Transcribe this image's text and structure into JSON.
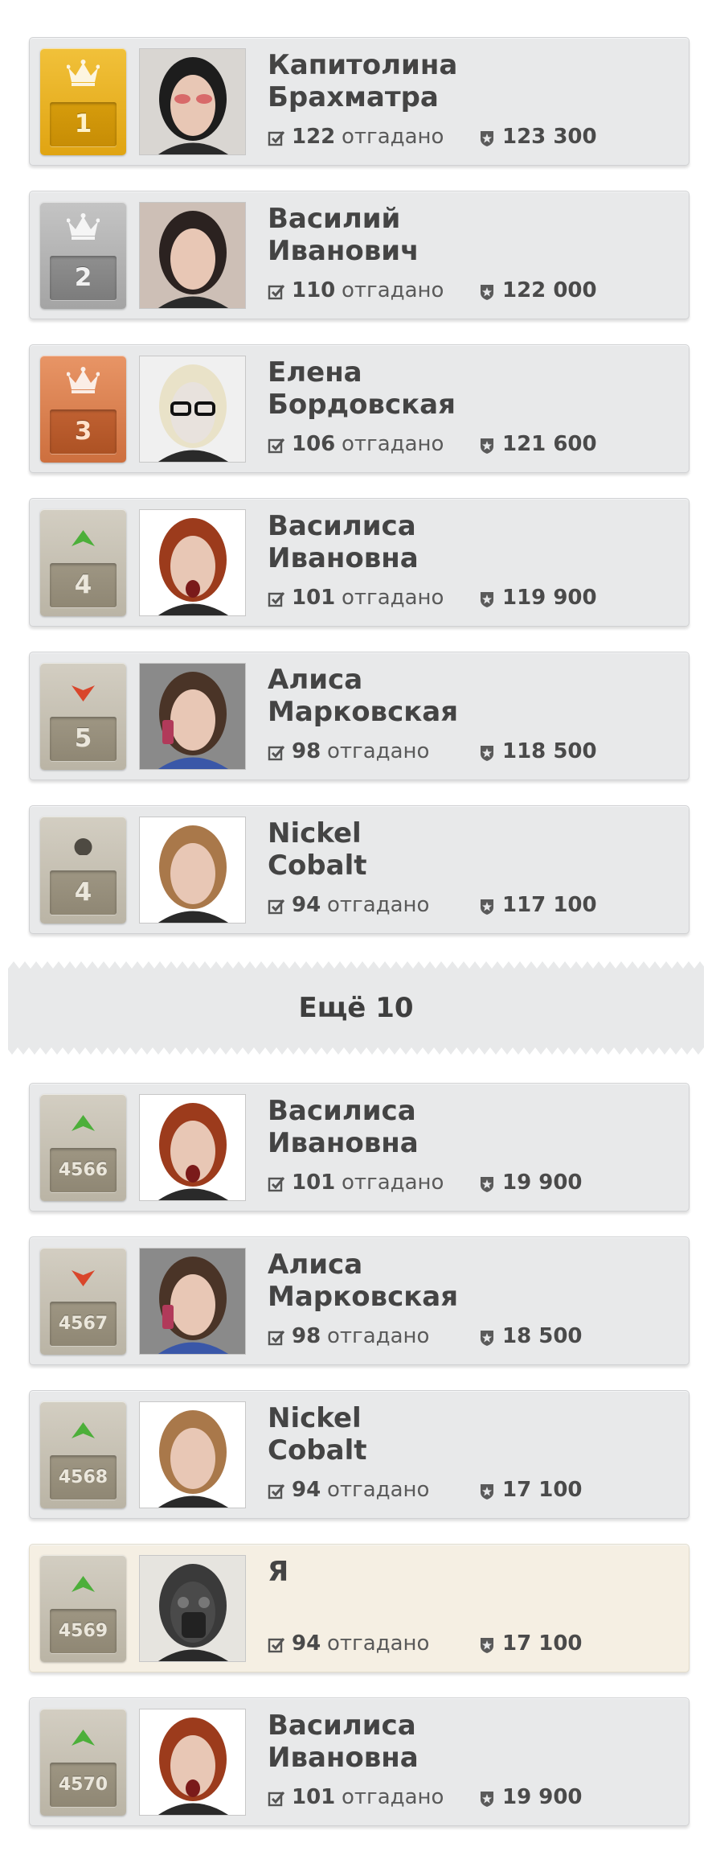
{
  "guessed_suffix": "отгадано",
  "more_button": {
    "label": "Ещё 10"
  },
  "top_rows": [
    {
      "badge": "gold",
      "status_icon": "crown-icon",
      "rank": "1",
      "name_lines": [
        "Капитолина",
        "Брахматра"
      ],
      "guessed": "122",
      "points": "123 300",
      "avatar": "portrait-red-eyes"
    },
    {
      "badge": "silver",
      "status_icon": "crown-icon",
      "rank": "2",
      "name_lines": [
        "Василий",
        "Иванович"
      ],
      "guessed": "110",
      "points": "122 000",
      "avatar": "portrait-fur-collar"
    },
    {
      "badge": "bronze",
      "status_icon": "crown-icon",
      "rank": "3",
      "name_lines": [
        "Елена",
        "Бордовская"
      ],
      "guessed": "106",
      "points": "121 600",
      "avatar": "portrait-glasses"
    },
    {
      "badge": "plain",
      "status_icon": "arrow-up-icon",
      "rank": "4",
      "name_lines": [
        "Василиса",
        "Ивановна"
      ],
      "guessed": "101",
      "points": "119 900",
      "avatar": "portrait-redhead"
    },
    {
      "badge": "plain",
      "status_icon": "arrow-down-icon",
      "rank": "5",
      "name_lines": [
        "Алиса",
        "Марковская"
      ],
      "guessed": "98",
      "points": "118 500",
      "avatar": "portrait-phone"
    },
    {
      "badge": "plain",
      "status_icon": "dot-icon",
      "rank": "4",
      "name_lines": [
        "Nickel",
        "Cobalt"
      ],
      "guessed": "94",
      "points": "117 100",
      "avatar": "portrait-braid"
    }
  ],
  "bottom_rows": [
    {
      "badge": "plain",
      "status_icon": "arrow-up-icon",
      "rank": "4566",
      "name_lines": [
        "Василиса",
        "Ивановна"
      ],
      "guessed": "101",
      "points": "19 900",
      "avatar": "portrait-redhead",
      "me": false
    },
    {
      "badge": "plain",
      "status_icon": "arrow-down-icon",
      "rank": "4567",
      "name_lines": [
        "Алиса",
        "Марковская"
      ],
      "guessed": "98",
      "points": "18 500",
      "avatar": "portrait-phone",
      "me": false
    },
    {
      "badge": "plain",
      "status_icon": "arrow-up-icon",
      "rank": "4568",
      "name_lines": [
        "Nickel",
        "Cobalt"
      ],
      "guessed": "94",
      "points": "17 100",
      "avatar": "portrait-braid",
      "me": false
    },
    {
      "badge": "plain",
      "status_icon": "arrow-up-icon",
      "rank": "4569",
      "name_lines": [
        "Я"
      ],
      "guessed": "94",
      "points": "17 100",
      "avatar": "portrait-mask",
      "me": true
    },
    {
      "badge": "plain",
      "status_icon": "arrow-up-icon",
      "rank": "4570",
      "name_lines": [
        "Василиса",
        "Ивановна"
      ],
      "guessed": "101",
      "points": "19 900",
      "avatar": "portrait-redhead",
      "me": false
    }
  ],
  "colors": {
    "card_bg": "#e8e9ea",
    "my_card_bg": "#f5efe3",
    "gold": "#e8b322",
    "silver": "#b3b3b3",
    "bronze": "#d9804e",
    "arrow_up": "#4caf3a",
    "arrow_down": "#d9462b"
  }
}
